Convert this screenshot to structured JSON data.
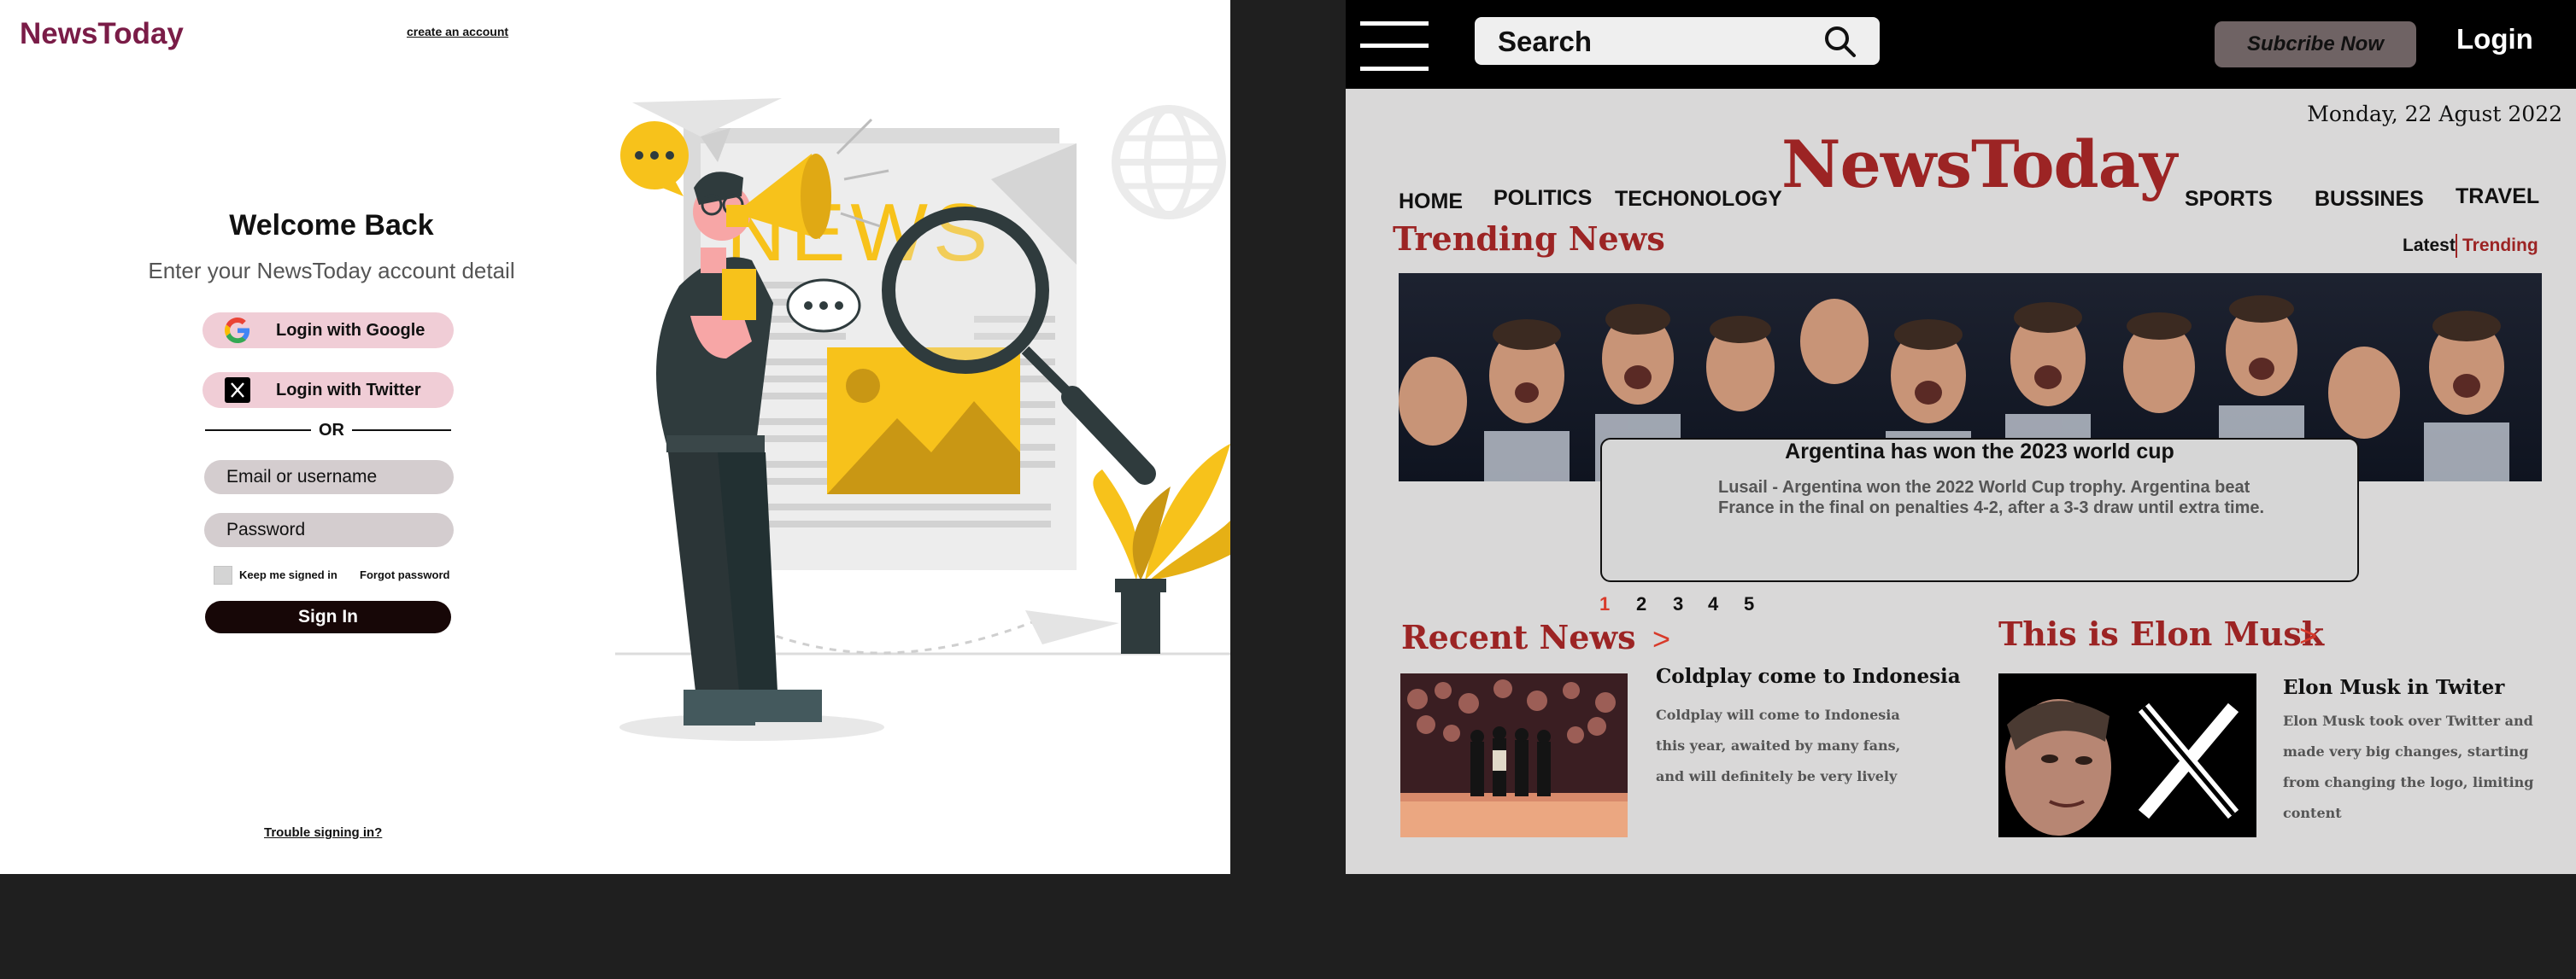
{
  "login_page": {
    "logo": "NewsToday",
    "create_account_link": "create an account",
    "welcome_title": "Welcome Back",
    "subtitle": "Enter your NewsToday account detail",
    "google_button": "Login with Google",
    "twitter_button": "Login with Twitter",
    "or_separator": "OR",
    "email_placeholder": "Email or username",
    "password_placeholder": "Password",
    "keep_signed_in": "Keep me signed in",
    "forgot_password": "Forgot password",
    "sign_in_button": "Sign In",
    "trouble_link": "Trouble signing in?",
    "illustration_text": "NEWS",
    "colors": {
      "accent": "#7a1c47",
      "button_pink": "#f0cdd6",
      "dark_button": "#170707",
      "illustration_yellow": "#f7c21b"
    }
  },
  "home_page": {
    "search": {
      "placeholder": "Search"
    },
    "subscribe_button": "Subcribe Now",
    "login_link": "Login",
    "date": "Monday, 22 Agust 2022",
    "brand": "NewsToday",
    "nav": {
      "home": "HOME",
      "politics": "POLITICS",
      "technology": "TECHONOLOGY",
      "sports": "SPORTS",
      "business": "BUSSINES",
      "travel": "TRAVEL"
    },
    "trending_title": "Trending News",
    "tabs": {
      "latest": "Latest",
      "trending": "Trending"
    },
    "featured": {
      "title": "Argentina has won the 2023 world cup",
      "body": "Lusail - Argentina won the 2022 World Cup trophy. Argentina beat France in the final on penalties 4-2, after a 3-3 draw until extra time."
    },
    "pagination": [
      "1",
      "2",
      "3",
      "4",
      "5"
    ],
    "active_page": "1",
    "recent_news": {
      "title": "Recent News",
      "arrow": ">",
      "headline": "Coldplay come to Indonesia",
      "body": "Coldplay will come to Indonesia this year, awaited by many fans, and will definitely be very lively"
    },
    "elon_section": {
      "title": "This is Elon Musk",
      "arrow": ">",
      "headline": "Elon Musk in Twiter",
      "body": "Elon Musk took over Twitter and made very big changes, starting from changing the logo, limiting content"
    },
    "colors": {
      "brand_red": "#9c2424",
      "active_red": "#d83a2a",
      "topbar": "#000000",
      "subscribe_bg": "#6f6364",
      "panel_bg": "#d9d8d8"
    }
  }
}
